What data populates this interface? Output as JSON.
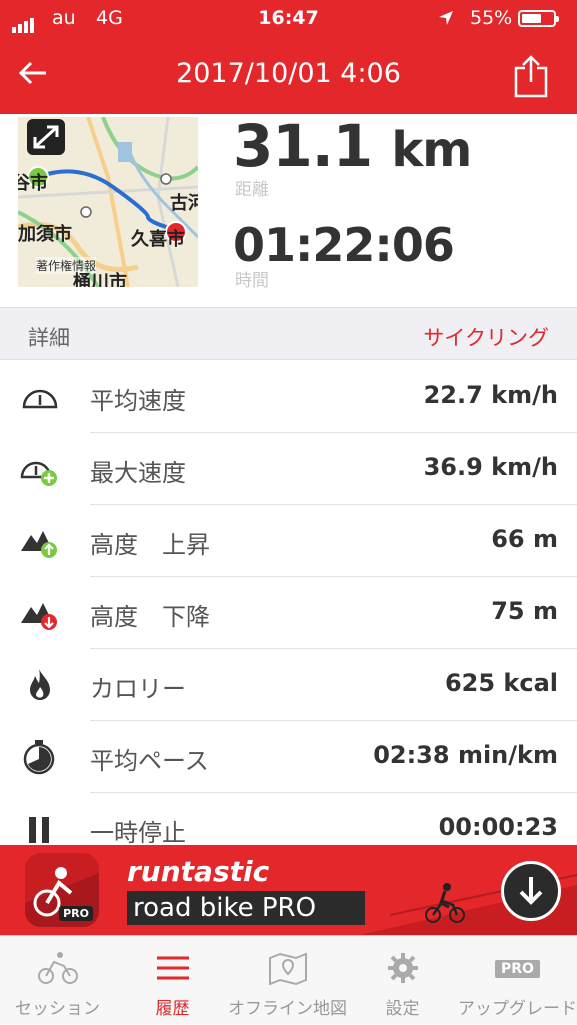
{
  "status_bar": {
    "carrier": "au",
    "network": "4G",
    "time": "16:47",
    "battery": "55%",
    "battery_level": 0.55
  },
  "nav": {
    "title": "2017/10/01 4:06"
  },
  "map": {
    "labels": [
      "谷市",
      "古河",
      "加須市",
      "久喜市",
      "著作権情報",
      "桶川市"
    ]
  },
  "summary": {
    "distance_value": "31.1",
    "distance_unit": "km",
    "distance_label": "距離",
    "duration_value": "01:22:06",
    "duration_label": "時間"
  },
  "section": {
    "title": "詳細",
    "activity": "サイクリング"
  },
  "rows": [
    {
      "icon": "speedometer-icon",
      "label": "平均速度",
      "value": "22.7 km/h"
    },
    {
      "icon": "max-speed-icon",
      "label": "最大速度",
      "value": "36.9 km/h"
    },
    {
      "icon": "elevation-gain-icon",
      "label": "高度　上昇",
      "value": "66 m"
    },
    {
      "icon": "elevation-loss-icon",
      "label": "高度　下降",
      "value": "75 m"
    },
    {
      "icon": "flame-icon",
      "label": "カロリー",
      "value": "625 kcal"
    },
    {
      "icon": "stopwatch-icon",
      "label": "平均ペース",
      "value": "02:38 min/km"
    },
    {
      "icon": "pause-icon",
      "label": "一時停止",
      "value": "00:00:23"
    }
  ],
  "banner": {
    "brand": "runtastic",
    "product": "road bike PRO",
    "badge": "PRO"
  },
  "tabs": [
    {
      "label": "セッション",
      "icon": "cycling-icon",
      "active": false
    },
    {
      "label": "履歴",
      "icon": "list-icon",
      "active": true
    },
    {
      "label": "オフライン地図",
      "icon": "map-icon",
      "active": false
    },
    {
      "label": "設定",
      "icon": "gear-icon",
      "active": false
    },
    {
      "label": "アップグレード",
      "icon": "pro-icon",
      "badge": "PRO",
      "active": false
    }
  ],
  "colors": {
    "accent": "#e3272b",
    "section_bg": "#efeff4",
    "green": "#7ac943"
  }
}
